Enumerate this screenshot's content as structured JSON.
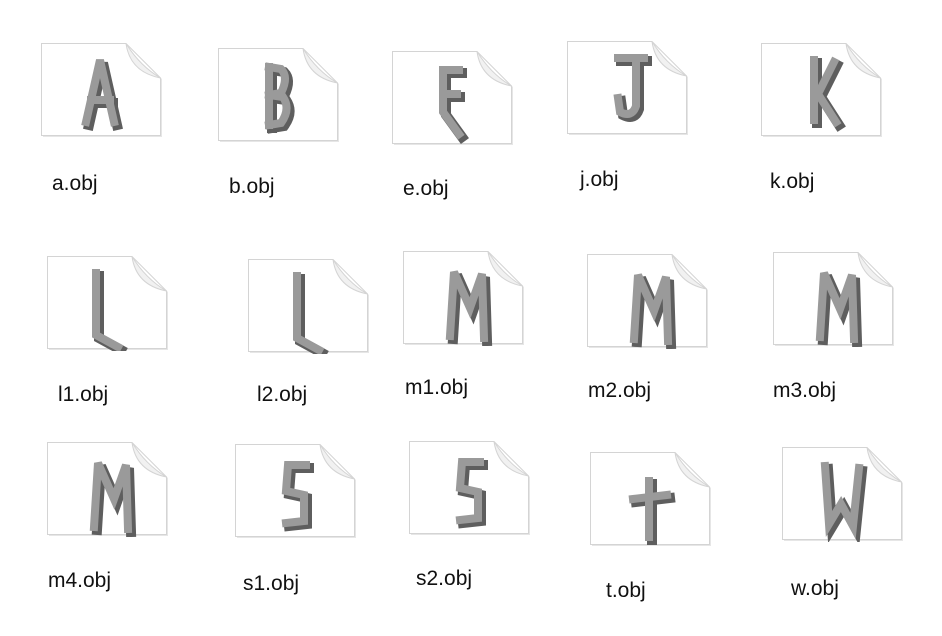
{
  "files": [
    {
      "name": "a.obj",
      "glyph": "A",
      "icon": "3d-letter-a-file-icon"
    },
    {
      "name": "b.obj",
      "glyph": "B",
      "icon": "3d-letter-b-file-icon"
    },
    {
      "name": "e.obj",
      "glyph": "E",
      "icon": "3d-letter-e-file-icon"
    },
    {
      "name": "j.obj",
      "glyph": "J",
      "icon": "3d-letter-j-file-icon"
    },
    {
      "name": "k.obj",
      "glyph": "K",
      "icon": "3d-letter-k-file-icon"
    },
    {
      "name": "l1.obj",
      "glyph": "L",
      "icon": "3d-letter-l-file-icon"
    },
    {
      "name": "l2.obj",
      "glyph": "L",
      "icon": "3d-letter-l-file-icon"
    },
    {
      "name": "m1.obj",
      "glyph": "M",
      "icon": "3d-letter-m-file-icon"
    },
    {
      "name": "m2.obj",
      "glyph": "M",
      "icon": "3d-letter-m-file-icon"
    },
    {
      "name": "m3.obj",
      "glyph": "M",
      "icon": "3d-letter-m-file-icon"
    },
    {
      "name": "m4.obj",
      "glyph": "M",
      "icon": "3d-letter-m-file-icon"
    },
    {
      "name": "s1.obj",
      "glyph": "S",
      "icon": "3d-letter-s-file-icon"
    },
    {
      "name": "s2.obj",
      "glyph": "S",
      "icon": "3d-letter-s-file-icon"
    },
    {
      "name": "t.obj",
      "glyph": "T",
      "icon": "3d-letter-t-file-icon"
    },
    {
      "name": "w.obj",
      "glyph": "W",
      "icon": "3d-letter-w-file-icon"
    }
  ],
  "colors": {
    "page_background": "#ffffff",
    "document_fill": "#ffffff",
    "document_border": "#d4d4d4",
    "letter_light": "#9a9a9a",
    "letter_dark": "#5e5e5e",
    "label_text": "#111111"
  }
}
